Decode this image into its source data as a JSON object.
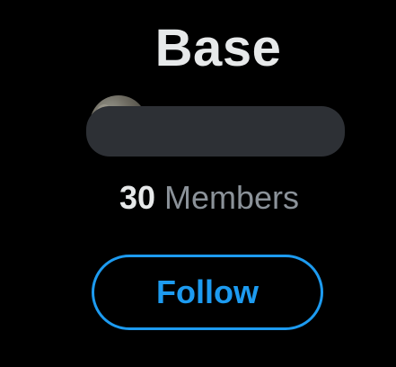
{
  "community": {
    "title": "Base",
    "members_count": "30",
    "members_label": "Members"
  },
  "follow_button": {
    "label": "Follow"
  },
  "colors": {
    "background": "#000000",
    "title": "#E7E9EA",
    "muted_text": "#8B9299",
    "accent": "#1D9BF0",
    "redaction": "#2D3035"
  }
}
